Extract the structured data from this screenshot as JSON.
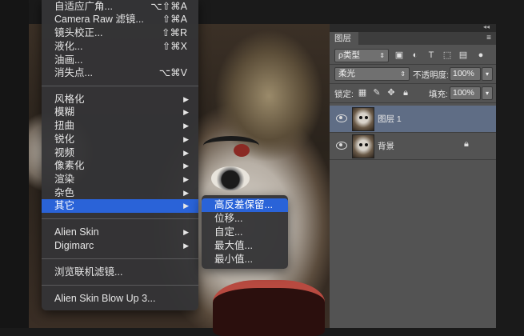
{
  "filter_menu": {
    "items_top": [
      {
        "label": "自适应广角...",
        "shortcut": "⌥⇧⌘A"
      },
      {
        "label": "Camera Raw 滤镜...",
        "shortcut": "⇧⌘A"
      },
      {
        "label": "镜头校正...",
        "shortcut": "⇧⌘R"
      },
      {
        "label": "液化...",
        "shortcut": "⇧⌘X"
      },
      {
        "label": "油画...",
        "shortcut": ""
      },
      {
        "label": "消失点...",
        "shortcut": "⌥⌘V"
      }
    ],
    "items_groups": [
      {
        "label": "风格化"
      },
      {
        "label": "模糊"
      },
      {
        "label": "扭曲"
      },
      {
        "label": "锐化"
      },
      {
        "label": "视频"
      },
      {
        "label": "像素化"
      },
      {
        "label": "渲染"
      },
      {
        "label": "杂色"
      },
      {
        "label": "其它"
      }
    ],
    "items_plugins": [
      {
        "label": "Alien Skin"
      },
      {
        "label": "Digimarc"
      }
    ],
    "browse_online": "浏览联机滤镜...",
    "last_item": "Alien Skin Blow Up 3..."
  },
  "other_submenu": {
    "items": [
      "高反差保留...",
      "位移...",
      "自定...",
      "最大值...",
      "最小值..."
    ]
  },
  "layers_panel": {
    "tab_label": "图层",
    "filter_kind": "ρ类型",
    "blend_mode": "柔光",
    "opacity_label": "不透明度:",
    "opacity_value": "100%",
    "lock_label": "锁定:",
    "fill_label": "填充:",
    "fill_value": "100%",
    "layers": [
      {
        "name": "图层 1",
        "active": true,
        "locked": false
      },
      {
        "name": "背景",
        "active": false,
        "locked": true
      }
    ]
  },
  "colors": {
    "menu_bg": "#343436",
    "highlight": "#2a63d8",
    "panel_bg": "#535353",
    "active_layer": "#5f6d85"
  }
}
